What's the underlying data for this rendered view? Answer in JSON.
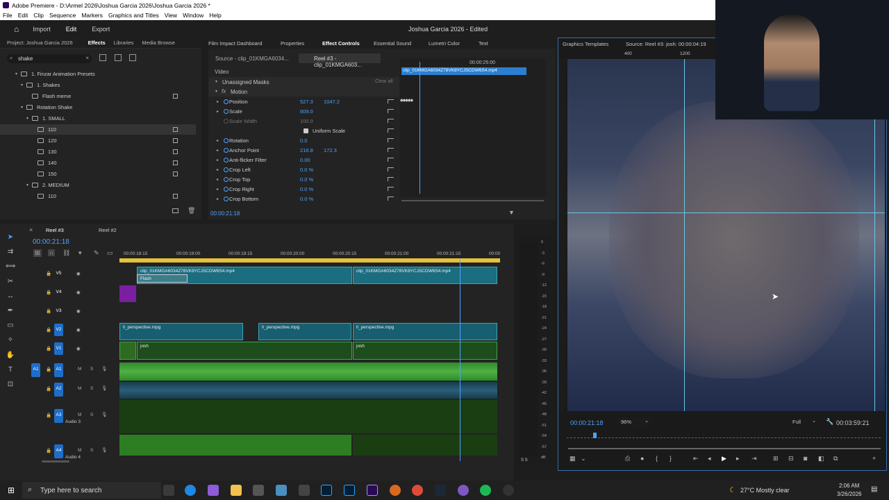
{
  "titlebar": {
    "text": "Adobe Premiere - D:\\Armel 2026\\Joshua Garcia 2026\\Joshua Garcia 2026 *"
  },
  "menu": [
    "File",
    "Edit",
    "Clip",
    "Sequence",
    "Markers",
    "Graphics and Titles",
    "View",
    "Window",
    "Help"
  ],
  "workspace": {
    "tabs": [
      "Import",
      "Edit",
      "Export"
    ],
    "active": "Edit",
    "project_title": "Joshua Garcia 2026 - Edited"
  },
  "left_panel": {
    "tabs": [
      "Project: Joshua Garcia 2026",
      "Effects",
      "Libraries",
      "Media Browse"
    ],
    "search": "shake",
    "tree": [
      {
        "label": "1. Finzar Animation Presets",
        "level": 0,
        "type": "folder"
      },
      {
        "label": "1. Shakes",
        "level": 1,
        "type": "folder"
      },
      {
        "label": "Flash meme",
        "level": 2,
        "type": "preset"
      },
      {
        "label": "Rotation Shake",
        "level": 1,
        "type": "folder"
      },
      {
        "label": "1. SMALL",
        "level": 2,
        "type": "folder"
      },
      {
        "label": "110",
        "level": 3,
        "type": "preset",
        "selected": true
      },
      {
        "label": "120",
        "level": 3,
        "type": "preset"
      },
      {
        "label": "130",
        "level": 3,
        "type": "preset"
      },
      {
        "label": "140",
        "level": 3,
        "type": "preset"
      },
      {
        "label": "150",
        "level": 3,
        "type": "preset"
      },
      {
        "label": "2. MEDIUM",
        "level": 2,
        "type": "folder"
      },
      {
        "label": "110",
        "level": 3,
        "type": "preset"
      }
    ]
  },
  "effect_controls": {
    "tabs": [
      "Film Impact Dashboard",
      "Properties",
      "Effect Controls",
      "Essential Sound",
      "Lumetri Color",
      "Text"
    ],
    "source_tab": "Source - clip_01KMGA6034...",
    "reel_tab": "Reel #3 - clip_01KMGA603...",
    "section": "Video",
    "unassigned": "Unassigned Masks",
    "clear_all": "Clear all",
    "motion": "Motion",
    "props": [
      {
        "name": "Position",
        "v1": "527.3",
        "v2": "1047.2"
      },
      {
        "name": "Scale",
        "v1": "609.0",
        "v2": ""
      },
      {
        "name": "Scale Width",
        "v1": "100.0",
        "v2": ""
      },
      {
        "name": "Uniform Scale",
        "v1": "",
        "v2": ""
      },
      {
        "name": "Rotation",
        "v1": "0.0",
        "v2": ""
      },
      {
        "name": "Anchor Point",
        "v1": "216.8",
        "v2": "172.3"
      },
      {
        "name": "Anti-flicker Filter",
        "v1": "0.00",
        "v2": ""
      },
      {
        "name": "Crop Left",
        "v1": "0.0 %",
        "v2": ""
      },
      {
        "name": "Crop Top",
        "v1": "0.0 %",
        "v2": ""
      },
      {
        "name": "Crop Right",
        "v1": "0.0 %",
        "v2": ""
      },
      {
        "name": "Crop Bottom",
        "v1": "0.0 %",
        "v2": ""
      }
    ],
    "mini_time": "00:00:25:00",
    "mini_clip": "clip_01KMGA6034Z78VK8YCJSCDW6S4.mp4",
    "current_time": "00:00:21:18"
  },
  "program": {
    "tabs": [
      "Graphics Templates",
      "Source: Reel #3: josh: 00:00:04:19"
    ],
    "ruler": [
      "400",
      "1200"
    ],
    "timecode": "00:00:21:18",
    "zoom": "96%",
    "quality": "Full",
    "duration": "00:03:59:21"
  },
  "timeline": {
    "tabs": [
      "Reel #3",
      "Reel #2"
    ],
    "timecode": "00:00:21:18",
    "ticks": [
      "00:00:18:15",
      "00:00:19:00",
      "00:00:19:15",
      "00:00:20:00",
      "00:00:20:15",
      "00:00:21:00",
      "00:00:21:15",
      "00:00"
    ],
    "tracks": [
      "V5",
      "V4",
      "V3",
      "V2",
      "V1",
      "A1",
      "A2",
      "A3",
      "A4"
    ],
    "audio3_name": "Audio 3",
    "audio4_name": "Audio 4",
    "clips": {
      "v5a": "clip_01KMGA6034Z78VK8YCJSCDW6S4.mp4",
      "v5b": "clip_01KMGA6034Z78VK8YCJSCDW6S4.mp4",
      "flash": "Flash",
      "v2a": "ll_perspective.mpg",
      "v2b": "ll_perspective.mpg",
      "v2c": "ll_perspective.mpg",
      "v1a": "josh",
      "v1b": "josh"
    }
  },
  "meter_scale": [
    "0",
    "-3",
    "-6",
    "-9",
    "-12",
    "-15",
    "-18",
    "-21",
    "-24",
    "-27",
    "-30",
    "-33",
    "-36",
    "-39",
    "-42",
    "-45",
    "-48",
    "-51",
    "-54",
    "-57",
    "dB"
  ],
  "meter_footer": "S S",
  "taskbar": {
    "search": "Type here to search",
    "weather": "27°C  Mostly clear",
    "time": "2:06 AM",
    "date": "3/26/2026"
  }
}
